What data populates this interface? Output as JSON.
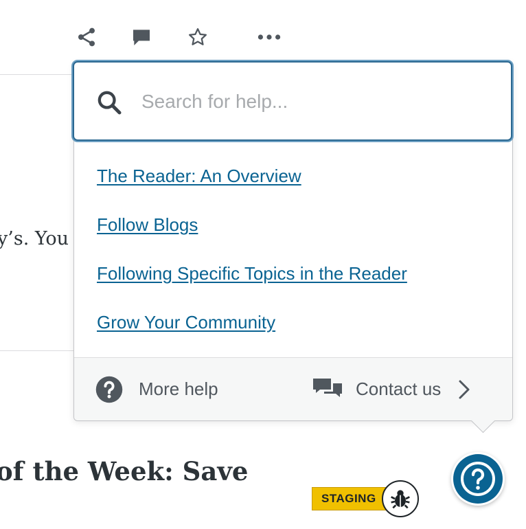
{
  "toolbar": {
    "share_icon": "share-icon",
    "comment_icon": "comment-icon",
    "star_icon": "star-icon",
    "more_icon": "ellipsis-icon"
  },
  "background": {
    "snippet_text": "y’s. You",
    "heading_text": "of the Week: Save"
  },
  "help_popover": {
    "search": {
      "placeholder": "Search for help..."
    },
    "links": [
      "The Reader: An Overview",
      "Follow Blogs",
      "Following Specific Topics in the Reader",
      "Grow Your Community"
    ],
    "footer": {
      "more_help_label": "More help",
      "contact_label": "Contact us"
    }
  },
  "staging_badge": {
    "label": "STAGING"
  },
  "colors": {
    "link": "#0a6392",
    "accent": "#2b6891",
    "fab": "#0a6392",
    "staging": "#f0c000"
  }
}
